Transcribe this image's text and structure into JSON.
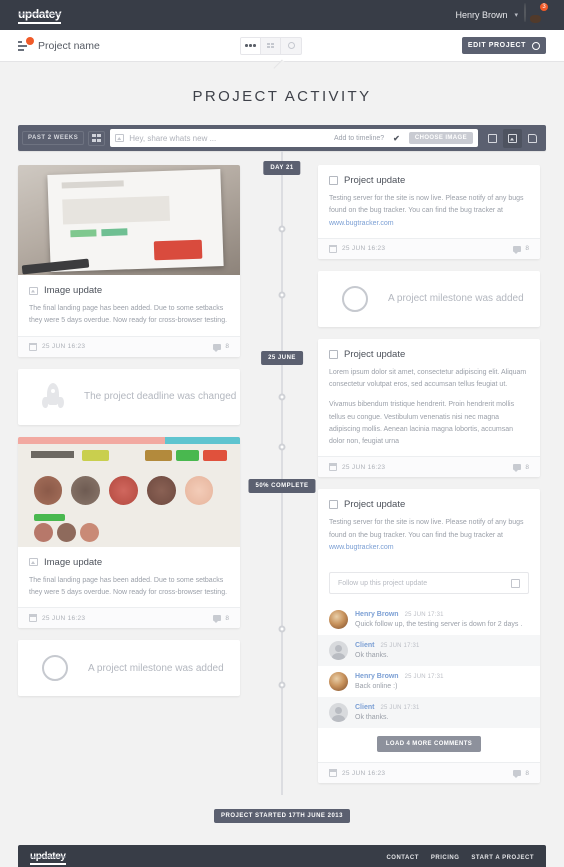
{
  "topnav": {
    "logo": "updatey",
    "user_name": "Henry Brown",
    "caret": "▾",
    "notification_count": "3"
  },
  "subheader": {
    "project_title": "Project name",
    "edit_button": "EDIT PROJECT",
    "view_modes": [
      "list-view",
      "grid-view",
      "circle-view"
    ]
  },
  "main": {
    "page_title": "PROJECT ACTIVITY"
  },
  "composer": {
    "range_label": "PAST 2 WEEKS",
    "placeholder": "Hey, share whats new ...",
    "add_to_timeline_label": "Add to timeline?",
    "checkmark": "✔",
    "choose_image_button": "CHOOSE IMAGE"
  },
  "timeline": {
    "badges": {
      "day21": "DAY 21",
      "date": "25 JUNE",
      "complete": "50% COMPLETE",
      "start": "PROJECT STARTED 17TH JUNE 2013"
    }
  },
  "left_column": [
    {
      "type": "image-update",
      "title": "Image update",
      "text": "The final landing page has been added. Due to some setbacks they were 5 days overdue. Now ready for cross-browser testing.",
      "date": "25 JUN 16:23",
      "comments": "8"
    },
    {
      "type": "event",
      "icon": "rocket-icon",
      "text": "The project deadline was changed"
    },
    {
      "type": "image-update",
      "title": "Image update",
      "text": "The final landing page has been added. Due to some setbacks they were 5 days overdue. Now ready for cross-browser testing.",
      "date": "25 JUN 16:23",
      "comments": "8"
    },
    {
      "type": "event",
      "icon": "circle-icon",
      "text": "A project milestone was added"
    }
  ],
  "right_column": {
    "card1": {
      "title": "Project update",
      "text_before_link": "Testing server for the site is now live. Please notify of any bugs found on the bug tracker. You can find the bug tracker at ",
      "link": "www.bugtracker.com",
      "date": "25 JUN 16:23",
      "comments": "8"
    },
    "milestone": {
      "icon": "circle-icon",
      "text": "A project milestone was added"
    },
    "card2": {
      "title": "Project update",
      "paragraph1": "Lorem ipsum dolor sit amet, consectetur adipiscing elit. Aliquam consectetur volutpat eros, sed accumsan tellus feugiat ut.",
      "paragraph2": "Vivamus bibendum tristique hendrerit. Proin hendrerit mollis tellus eu congue. Vestibulum venenatis nisi nec magna adipiscing mollis. Aenean lacinia magna lobortis, accumsan dolor non, feugiat urna",
      "date": "25 JUN 16:23",
      "comments": "8"
    },
    "card3": {
      "title": "Project update",
      "text_before_link": "Testing server for the site is now live. Please notify of any bugs found on the bug tracker. You can find the bug tracker at ",
      "link": "www.bugtracker.com",
      "follow_placeholder": "Follow up this project update",
      "comments": [
        {
          "author": "Henry Brown",
          "avatar": "henry",
          "time": "25 JUN 17:31",
          "text": "Quick follow up, the testing server is down for 2 days ."
        },
        {
          "author": "Client",
          "avatar": "client",
          "time": "25 JUN 17:31",
          "text": "Ok thanks."
        },
        {
          "author": "Henry Brown",
          "avatar": "henry",
          "time": "25 JUN 17:31",
          "text": "Back online :)"
        },
        {
          "author": "Client",
          "avatar": "client",
          "time": "25 JUN 17:31",
          "text": "Ok thanks."
        }
      ],
      "load_more_button": "LOAD 4 MORE COMMENTS",
      "date": "25 JUN 16:23",
      "comments_count": "8"
    }
  },
  "footer": {
    "logo": "updatey",
    "links": [
      "CONTACT",
      "PRICING",
      "START A PROJECT"
    ]
  },
  "colors": {
    "dark": "#383d47",
    "slate": "#5b6070",
    "accent_orange": "#f05a28",
    "link_blue": "#7b9fd4",
    "page_bg": "#f2f2f2"
  }
}
